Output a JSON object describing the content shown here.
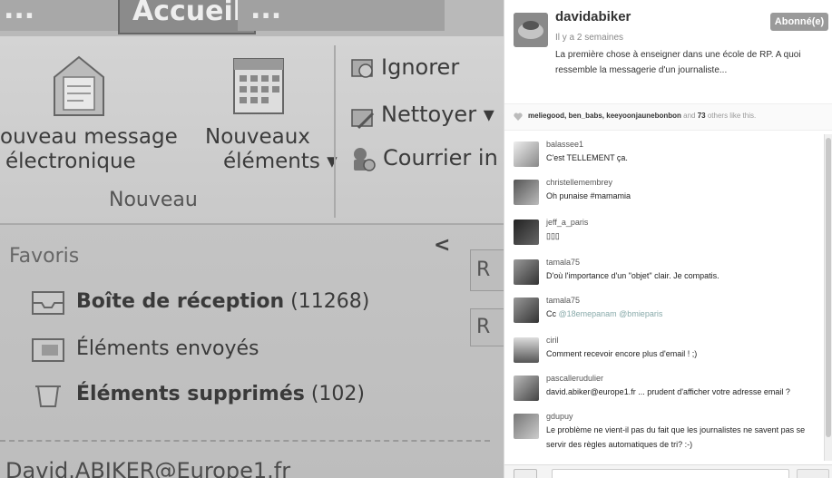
{
  "photo": {
    "tabs": {
      "first": "...",
      "home": "Accueil",
      "other": "..."
    },
    "ribbon": {
      "new_message": [
        "ouveau message",
        "électronique"
      ],
      "new_items": [
        "Nouveaux",
        "éléments ▾"
      ],
      "group_new": "Nouveau",
      "ignore": "Ignorer",
      "clean": "Nettoyer ▾",
      "junk": "Courrier in"
    },
    "favorites": {
      "title": "Favoris",
      "collapse": "<",
      "items": [
        {
          "label": "Boîte de réception",
          "count": " (11268)"
        },
        {
          "label": "Éléments envoyés",
          "count": ""
        },
        {
          "label": "Éléments supprimés",
          "count": " (102)"
        }
      ]
    },
    "right_boxes": [
      "R",
      "R"
    ],
    "footer": "David.ABIKER@Europe1.fr"
  },
  "post": {
    "username": "davidabiker",
    "time": "Il y a 2 semaines",
    "caption": "La première chose à enseigner dans une école de RP. A quoi ressemble la messagerie d'un journaliste...",
    "follow_label": "Abonné(e)",
    "likes_users": "meliegood, ben_babs, keeyoonjaunebonbon",
    "likes_and": " and ",
    "likes_count": "73",
    "likes_tail": " others like this."
  },
  "comments": [
    {
      "user": "balassee1",
      "text": "C'est TELLEMENT ça."
    },
    {
      "user": "christellemembrey",
      "text": "Oh punaise #mamamia"
    },
    {
      "user": "jeff_a_paris",
      "text": "▯▯▯"
    },
    {
      "user": "tamala75",
      "text": "D'où l'importance d'un \"objet\" clair. Je compatis."
    },
    {
      "user": "tamala75",
      "text_prefix": "Cc ",
      "mentions": "@18emepanam @bmieparis"
    },
    {
      "user": "ciril",
      "text": "Comment recevoir encore plus d'email ! ;)"
    },
    {
      "user": "pascallerudulier",
      "text": "david.abiker@europe1.fr ... prudent d'afficher votre adresse email ?"
    },
    {
      "user": "gdupuy",
      "text": "Le problème ne vient-il pas du fait que les journalistes ne savent pas se servir des règles automatiques de tri? :-)"
    }
  ],
  "colors": {
    "follow_bg": "#9a9a9a",
    "panel_bg": "#ffffff",
    "photo_tone": "#c4c4c4"
  }
}
